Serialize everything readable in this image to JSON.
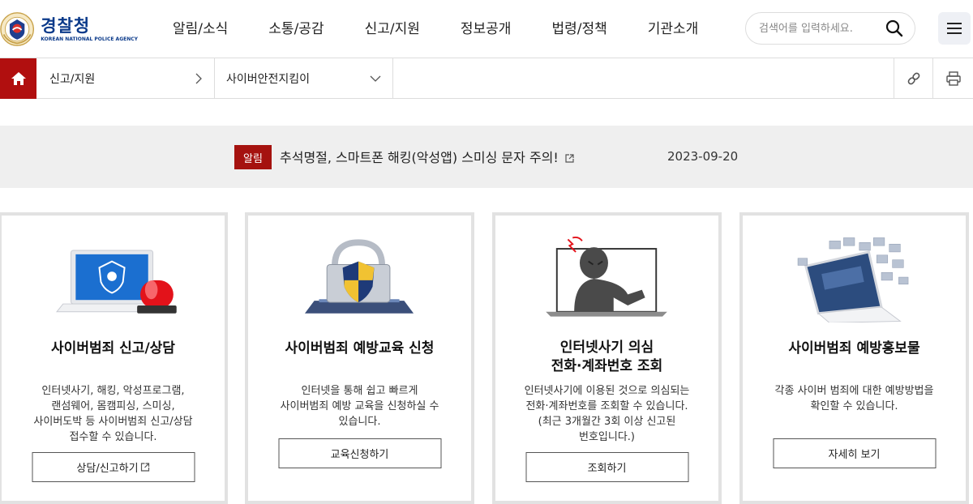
{
  "brand": {
    "title": "경찰청",
    "subtitle": "KOREAN NATIONAL POLICE AGENCY"
  },
  "gnb": [
    "알림/소식",
    "소통/공감",
    "신고/지원",
    "정보공개",
    "법령/정책",
    "기관소개"
  ],
  "search": {
    "placeholder": "검색어를 입력하세요."
  },
  "location": {
    "depth1": "신고/지원",
    "depth2": "사이버안전지킴이"
  },
  "notice": {
    "badge": "알림",
    "text": "추석명절, 스마트폰 해킹(악성앱) 스미싱 문자 주의!",
    "date": "2023-09-20"
  },
  "cards": [
    {
      "title": "사이버범죄 신고/상담",
      "desc": "인터넷사기, 해킹, 악성프로그램,\n랜섬웨어, 몸캠피싱, 스미싱,\n사이버도박 등 사이버범죄 신고/상담\n접수할 수 있습니다.",
      "button": "상담/신고하기"
    },
    {
      "title": "사이버범죄 예방교육 신청",
      "desc": "인터넷을 통해 쉽고 빠르게\n사이버범죄 예방 교육을 신청하실 수\n있습니다.",
      "button": "교육신청하기"
    },
    {
      "title": "인터넷사기 의심\n전화·계좌번호 조회",
      "desc": "인터넷사기에 이용된 것으로 의심되는\n전화·계좌번호를 조회할 수 있습니다.\n(최근 3개월간 3회 이상 신고된\n번호입니다.)",
      "button": "조회하기"
    },
    {
      "title": "사이버범죄 예방홍보물",
      "desc": "각종 사이버 범죄에 대한 예방방법을\n확인할 수 있습니다.",
      "button": "자세히 보기"
    }
  ],
  "colors": {
    "brand_blue": "#0b3a8a",
    "accent_red": "#a5120f",
    "home_red": "#b10f0f"
  }
}
